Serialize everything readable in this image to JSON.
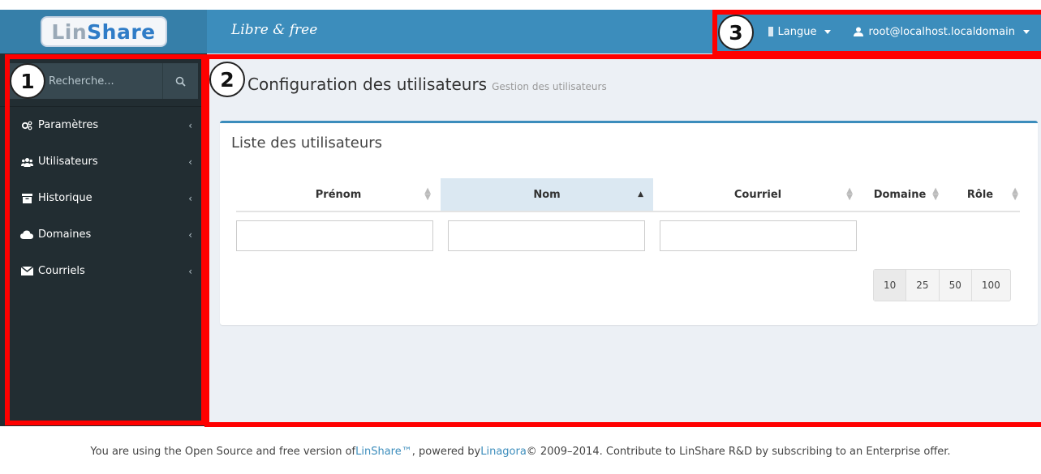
{
  "header": {
    "logo": {
      "part1": "Lin",
      "part2": "Share"
    },
    "tagline": "Libre & free",
    "language_label": "Langue",
    "user_label": "root@localhost.localdomain"
  },
  "sidebar": {
    "search": {
      "placeholder": "Recherche..."
    },
    "items": [
      {
        "label": "Paramètres",
        "icon": "cogs-icon"
      },
      {
        "label": "Utilisateurs",
        "icon": "users-icon"
      },
      {
        "label": "Historique",
        "icon": "archive-icon"
      },
      {
        "label": "Domaines",
        "icon": "cloud-icon"
      },
      {
        "label": "Courriels",
        "icon": "envelope-icon"
      }
    ]
  },
  "main": {
    "title": "Configuration des utilisateurs",
    "subtitle": "Gestion des utilisateurs",
    "box_title": "Liste des utilisateurs",
    "columns": [
      "Prénom",
      "Nom",
      "Courriel",
      "Domaine",
      "Rôle"
    ],
    "sorted_column": "Nom",
    "page_sizes": [
      "10",
      "25",
      "50",
      "100"
    ],
    "selected_page_size": "10"
  },
  "annotations": [
    "1",
    "2",
    "3"
  ],
  "footer": {
    "text1": "You are using the Open Source and free version of ",
    "link1": "LinShare™",
    "text2": ", powered by ",
    "link2": "Linagora",
    "text3": " © 2009–2014. Contribute to LinShare R&D by subscribing to an Enterprise offer."
  },
  "colors": {
    "navbar": "#3c8dbc",
    "sidebar": "#222d32",
    "annotation": "#ff0000"
  }
}
